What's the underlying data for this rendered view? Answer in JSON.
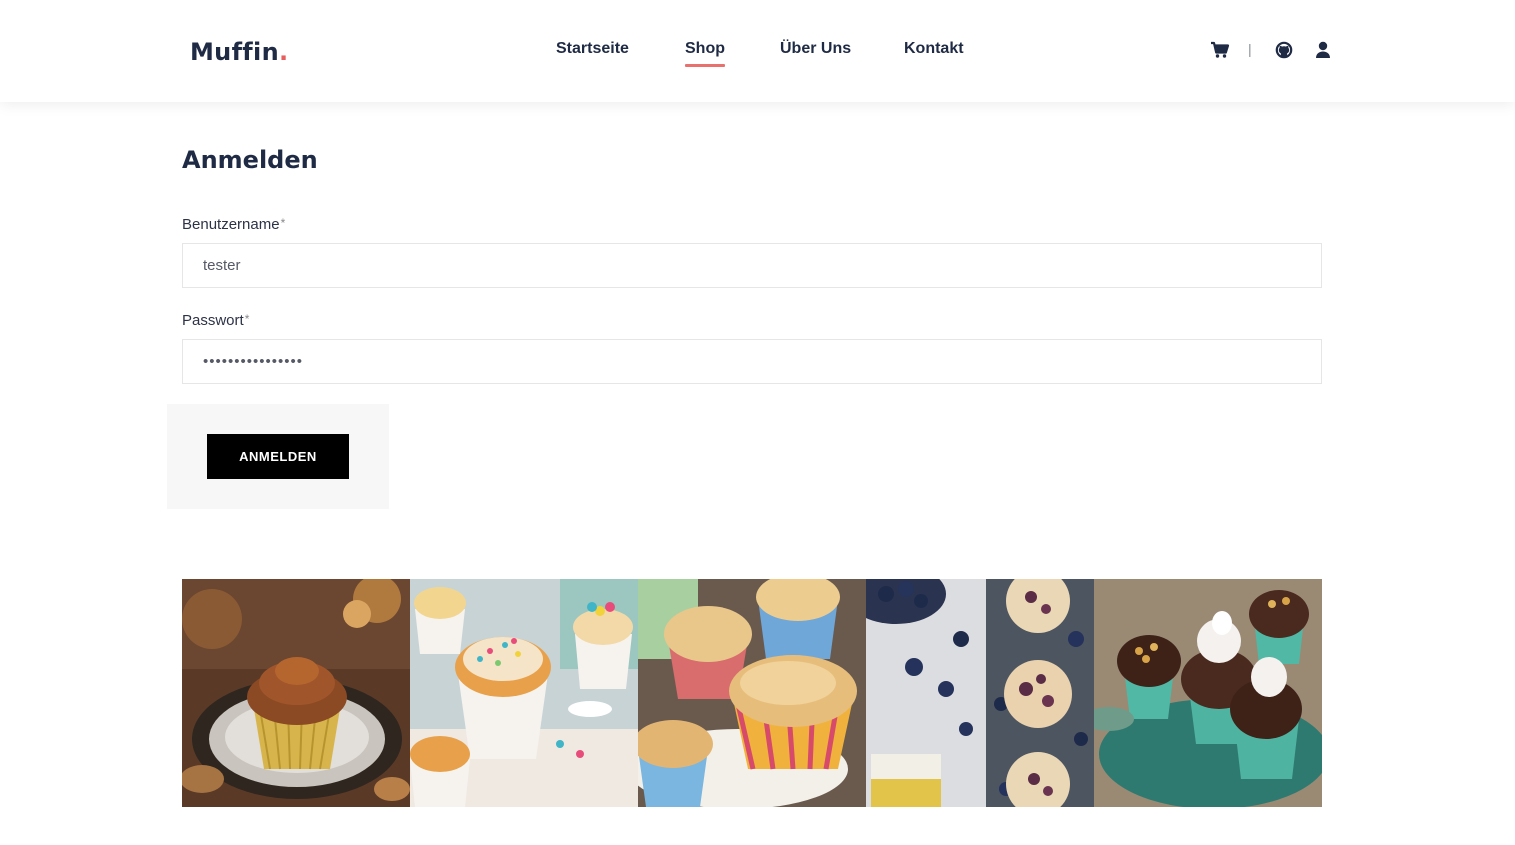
{
  "header": {
    "logo_text": "Muffin",
    "logo_dot": ".",
    "nav": [
      {
        "label": "Startseite",
        "active": false
      },
      {
        "label": "Shop",
        "active": true
      },
      {
        "label": "Über Uns",
        "active": false
      },
      {
        "label": "Kontakt",
        "active": false
      }
    ],
    "icons": [
      "cart-icon",
      "github-icon",
      "user-icon"
    ],
    "separator": "|",
    "accent_color": "#e8716d"
  },
  "login": {
    "title": "Anmelden",
    "username_label": "Benutzername",
    "username_required": "*",
    "username_value": "tester",
    "password_label": "Passwort",
    "password_required": "*",
    "password_value": "••••••••••••••••",
    "submit_label": "ANMELDEN"
  },
  "gallery": {
    "images": [
      {
        "name": "chocolate-cupcake-image"
      },
      {
        "name": "sprinkle-muffins-image"
      },
      {
        "name": "vanilla-muffins-image"
      },
      {
        "name": "blueberry-muffins-image"
      },
      {
        "name": "meringue-cupcakes-image"
      }
    ]
  }
}
